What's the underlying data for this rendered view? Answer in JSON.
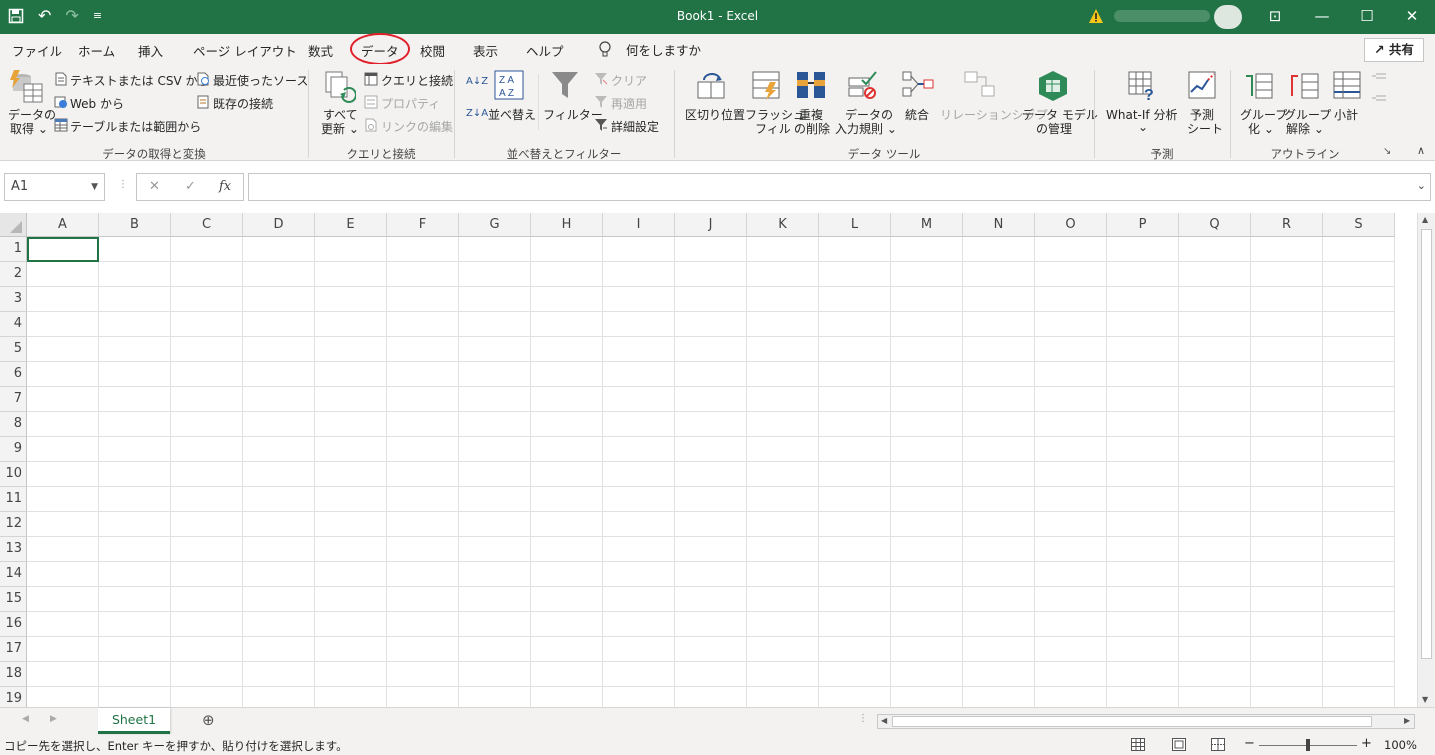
{
  "window": {
    "title": "Book1  -  Excel",
    "minimize_glyph": "—",
    "restore_glyph": "☐",
    "close_glyph": "✕",
    "ribbon_display_glyph": "⊡"
  },
  "qat": {
    "save_icon": "save-icon",
    "undo_glyph": "↶",
    "redo_glyph": "↷",
    "more_glyph": "⌄",
    "customize_glyph": "≡"
  },
  "tabs": [
    {
      "label": "ファイル"
    },
    {
      "label": "ホーム"
    },
    {
      "label": "挿入"
    },
    {
      "label": "ページ レイアウト"
    },
    {
      "label": "数式"
    },
    {
      "label": "データ"
    },
    {
      "label": "校閲"
    },
    {
      "label": "表示"
    },
    {
      "label": "ヘルプ"
    }
  ],
  "tellme": {
    "label": "何をしますか"
  },
  "share": {
    "label": "共有",
    "icon": "↗"
  },
  "ribbon": {
    "get_data": {
      "big_label_1": "データの",
      "big_label_2": "取得 ⌄",
      "text_csv": "テキストまたは CSV から",
      "web": "Web から",
      "table_range": "テーブルまたは範囲から",
      "recent_sources": "最近使ったソース",
      "existing_connections": "既存の接続",
      "group_label": "データの取得と変換"
    },
    "queries": {
      "refresh_1": "すべて",
      "refresh_2": "更新 ⌄",
      "queries_connections": "クエリと接続",
      "properties": "プロパティ",
      "edit_links": "リンクの編集",
      "group_label": "クエリと接続"
    },
    "sort_filter": {
      "sort_az": "A↓Z",
      "sort_za": "Z↓A",
      "sort": "並べ替え",
      "filter": "フィルター",
      "clear": "クリア",
      "reapply": "再適用",
      "advanced": "詳細設定",
      "group_label": "並べ替えとフィルター"
    },
    "data_tools": {
      "text_to_columns": "区切り位置",
      "flash_fill_1": "フラッシュ",
      "flash_fill_2": "フィル",
      "remove_dup_1": "重複",
      "remove_dup_2": "の削除",
      "validation_1": "データの",
      "validation_2": "入力規則 ⌄",
      "consolidate": "統合",
      "relationships": "リレーションシップ",
      "data_model_1": "データ モデル",
      "data_model_2": "の管理",
      "group_label": "データ ツール"
    },
    "forecast": {
      "whatif_1": "What-If 分析",
      "whatif_2": "⌄",
      "forecast_1": "予測",
      "forecast_2": "シート",
      "group_label": "予測"
    },
    "outline": {
      "group_1": "グループ",
      "group_2": "化 ⌄",
      "ungroup_1": "グループ",
      "ungroup_2": "解除 ⌄",
      "subtotal": "小計",
      "group_label": "アウトライン",
      "launcher": "↘"
    },
    "collapse_glyph": "∧"
  },
  "formula_bar": {
    "name_box": "A1",
    "cancel": "✕",
    "enter": "✓",
    "fx": "fx",
    "value": ""
  },
  "grid": {
    "columns": [
      "A",
      "B",
      "C",
      "D",
      "E",
      "F",
      "G",
      "H",
      "I",
      "J",
      "K",
      "L",
      "M",
      "N",
      "O",
      "P",
      "Q",
      "R",
      "S"
    ],
    "rows": [
      "1",
      "2",
      "3",
      "4",
      "5",
      "6",
      "7",
      "8",
      "9",
      "10",
      "11",
      "12",
      "13",
      "14",
      "15",
      "16",
      "17",
      "18",
      "19"
    ]
  },
  "sheets": [
    {
      "label": "Sheet1"
    }
  ],
  "new_sheet_glyph": "⊕",
  "status": {
    "message": "コピー先を選択し、Enter キーを押すか、貼り付けを選択します。",
    "zoom": "100%",
    "zoom_minus": "−",
    "zoom_plus": "+"
  },
  "colors": {
    "accent": "#217346",
    "highlight_circle": "#e0202a"
  }
}
